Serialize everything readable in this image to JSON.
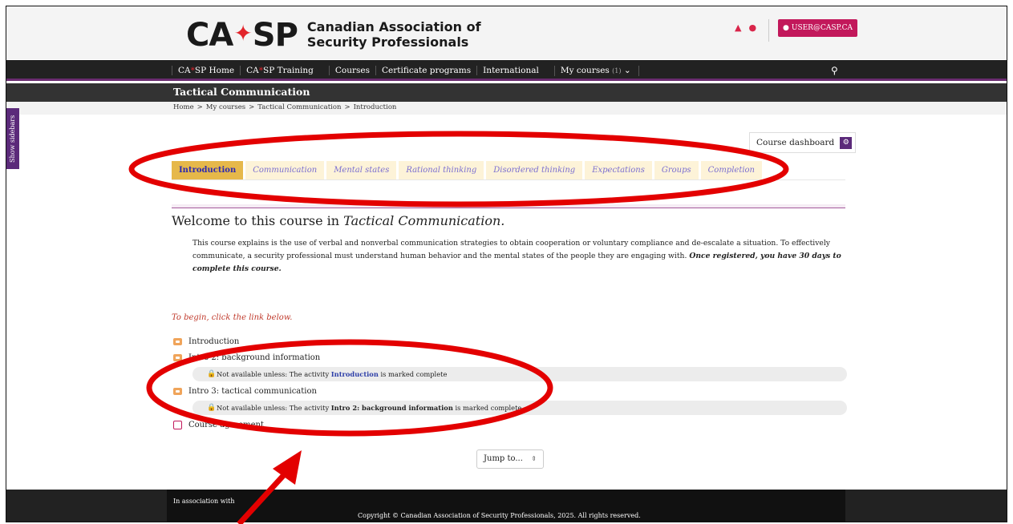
{
  "header": {
    "logo_mark": "CA",
    "logo_mark2": "SP",
    "logo_line1": "Canadian Association of",
    "logo_line2": "Security Professionals",
    "user_button": "USER@CASP.CA"
  },
  "nav": {
    "items": [
      {
        "label": "CA",
        "label2": "SP Home"
      },
      {
        "label": "CA",
        "label2": "SP Training"
      },
      {
        "label": "Courses"
      },
      {
        "label": "Certificate programs"
      },
      {
        "label": "International"
      },
      {
        "label": "My courses",
        "count": "(1)"
      }
    ]
  },
  "course": {
    "title": "Tactical Communication",
    "breadcrumb": [
      "Home",
      ">",
      "My courses",
      ">",
      "Tactical Communication",
      ">",
      "Introduction"
    ]
  },
  "sidebar_toggle": "Show sidebars",
  "dashboard_button": "Course dashboard",
  "tabs": [
    "Introduction",
    "Communication",
    "Mental states",
    "Rational thinking",
    "Disordered thinking",
    "Expectations",
    "Groups",
    "Completion"
  ],
  "main": {
    "welcome_prefix": "Welcome to this course in ",
    "welcome_course": "Tactical Communication.",
    "paragraph": "This course explains is the use of verbal and nonverbal communication strategies to obtain cooperation or voluntary compliance and de-escalate a situation. To effectively communicate, a security professional must understand human behavior and the mental states of the people they are engaging with. ",
    "paragraph_bold": "Once registered, you have 30 days to complete this course.",
    "begin": "To begin, click the link below."
  },
  "activities": {
    "a1": "Introduction",
    "a2": "Intro 2: background information",
    "r1_prefix": "Not available unless: The activity ",
    "r1_link": "Introduction",
    "r1_suffix": " is marked complete",
    "a3": "Intro 3: tactical communication",
    "r2_prefix": "Not available unless: The activity ",
    "r2_bold": "Intro 2: background information",
    "r2_suffix": " is marked complete",
    "a4": "Course agreement"
  },
  "jump_to": "Jump to...",
  "footer": {
    "assoc": "In association with",
    "copyright": "Copyright © Canadian Association of Security Professionals, 2025. All rights reserved."
  },
  "colors": {
    "accent_purple": "#5b2a7a",
    "user_button": "#c2185b",
    "tab_active": "#e6b84a",
    "annotation_red": "#e30000"
  },
  "icons": [
    "bell-icon",
    "chat-icon",
    "user-icon",
    "search-icon",
    "gear-icon",
    "lock-icon",
    "page-icon",
    "book-icon",
    "chevron-down-icon"
  ]
}
